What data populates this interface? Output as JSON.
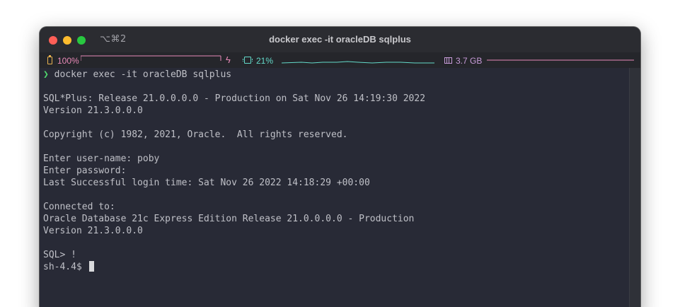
{
  "window": {
    "title": "docker exec -it oracleDB sqlplus",
    "shortcut": "⌥⌘2"
  },
  "status_bar": {
    "battery": {
      "label": "100%",
      "icon": "battery-icon",
      "color": "#e88ab8",
      "icon_color": "#e9b24f"
    },
    "cpu": {
      "label": "21%",
      "icon": "cpu-icon",
      "color": "#63d9c9"
    },
    "memory": {
      "label": "3.7 GB",
      "icon": "memory-icon",
      "color": "#c79bd8"
    }
  },
  "terminal": {
    "prompt_symbol": "❯",
    "command": "docker exec -it oracleDB sqlplus",
    "lines": [
      "SQL*Plus: Release 21.0.0.0.0 - Production on Sat Nov 26 14:19:30 2022",
      "Version 21.3.0.0.0",
      "Copyright (c) 1982, 2021, Oracle.  All rights reserved.",
      "Enter user-name: poby",
      "Enter password:",
      "Last Successful login time: Sat Nov 26 2022 14:18:29 +00:00",
      "Connected to:",
      "Oracle Database 21c Express Edition Release 21.0.0.0.0 - Production",
      "Version 21.3.0.0.0",
      "SQL> !",
      "sh-4.4$"
    ]
  },
  "colors": {
    "terminal_bg": "#282a36",
    "terminal_fg": "#bfc0c7",
    "prompt_green": "#50d86e",
    "close": "#ff5f57",
    "minimize": "#febc2e",
    "maximize": "#28c840"
  }
}
